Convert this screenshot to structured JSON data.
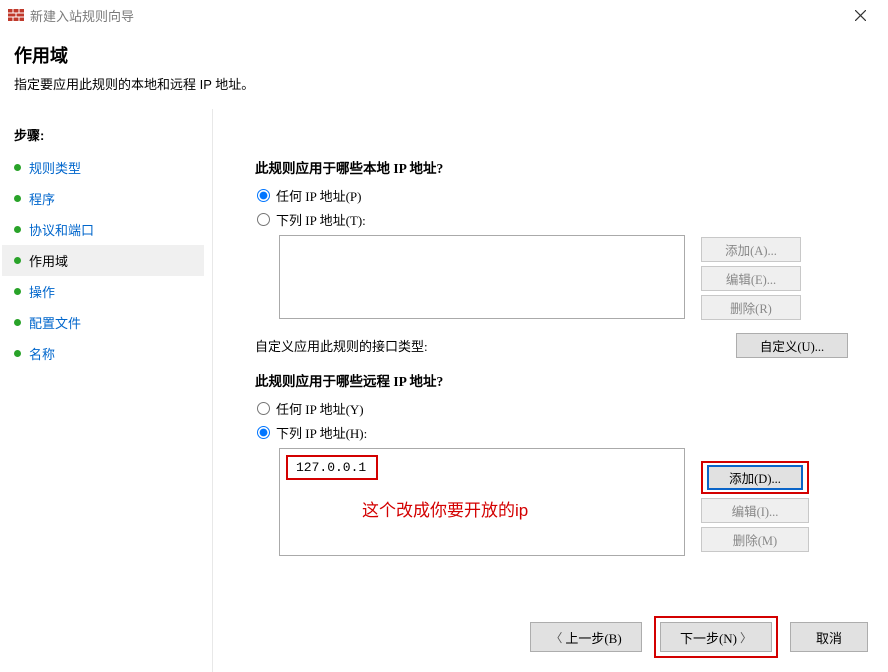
{
  "window": {
    "title": "新建入站规则向导"
  },
  "header": {
    "title": "作用域",
    "subtitle": "指定要应用此规则的本地和远程 IP 地址。"
  },
  "sidebar": {
    "steps_label": "步骤:",
    "items": [
      {
        "label": "规则类型"
      },
      {
        "label": "程序"
      },
      {
        "label": "协议和端口"
      },
      {
        "label": "作用域"
      },
      {
        "label": "操作"
      },
      {
        "label": "配置文件"
      },
      {
        "label": "名称"
      }
    ]
  },
  "local": {
    "title": "此规则应用于哪些本地 IP 地址?",
    "opt_any": "任何 IP 地址(P)",
    "opt_these": "下列 IP 地址(T):",
    "add": "添加(A)...",
    "edit": "编辑(E)...",
    "remove": "删除(R)"
  },
  "custom": {
    "label": "自定义应用此规则的接口类型:",
    "button": "自定义(U)..."
  },
  "remote": {
    "title": "此规则应用于哪些远程 IP 地址?",
    "opt_any": "任何 IP 地址(Y)",
    "opt_these": "下列 IP 地址(H):",
    "ip_value": "127.0.0.1",
    "add": "添加(D)...",
    "edit": "编辑(I)...",
    "remove": "删除(M)"
  },
  "hint": "这个改成你要开放的ip",
  "footer": {
    "back": "上一步(B)",
    "next": "下一步(N)",
    "cancel": "取消"
  }
}
